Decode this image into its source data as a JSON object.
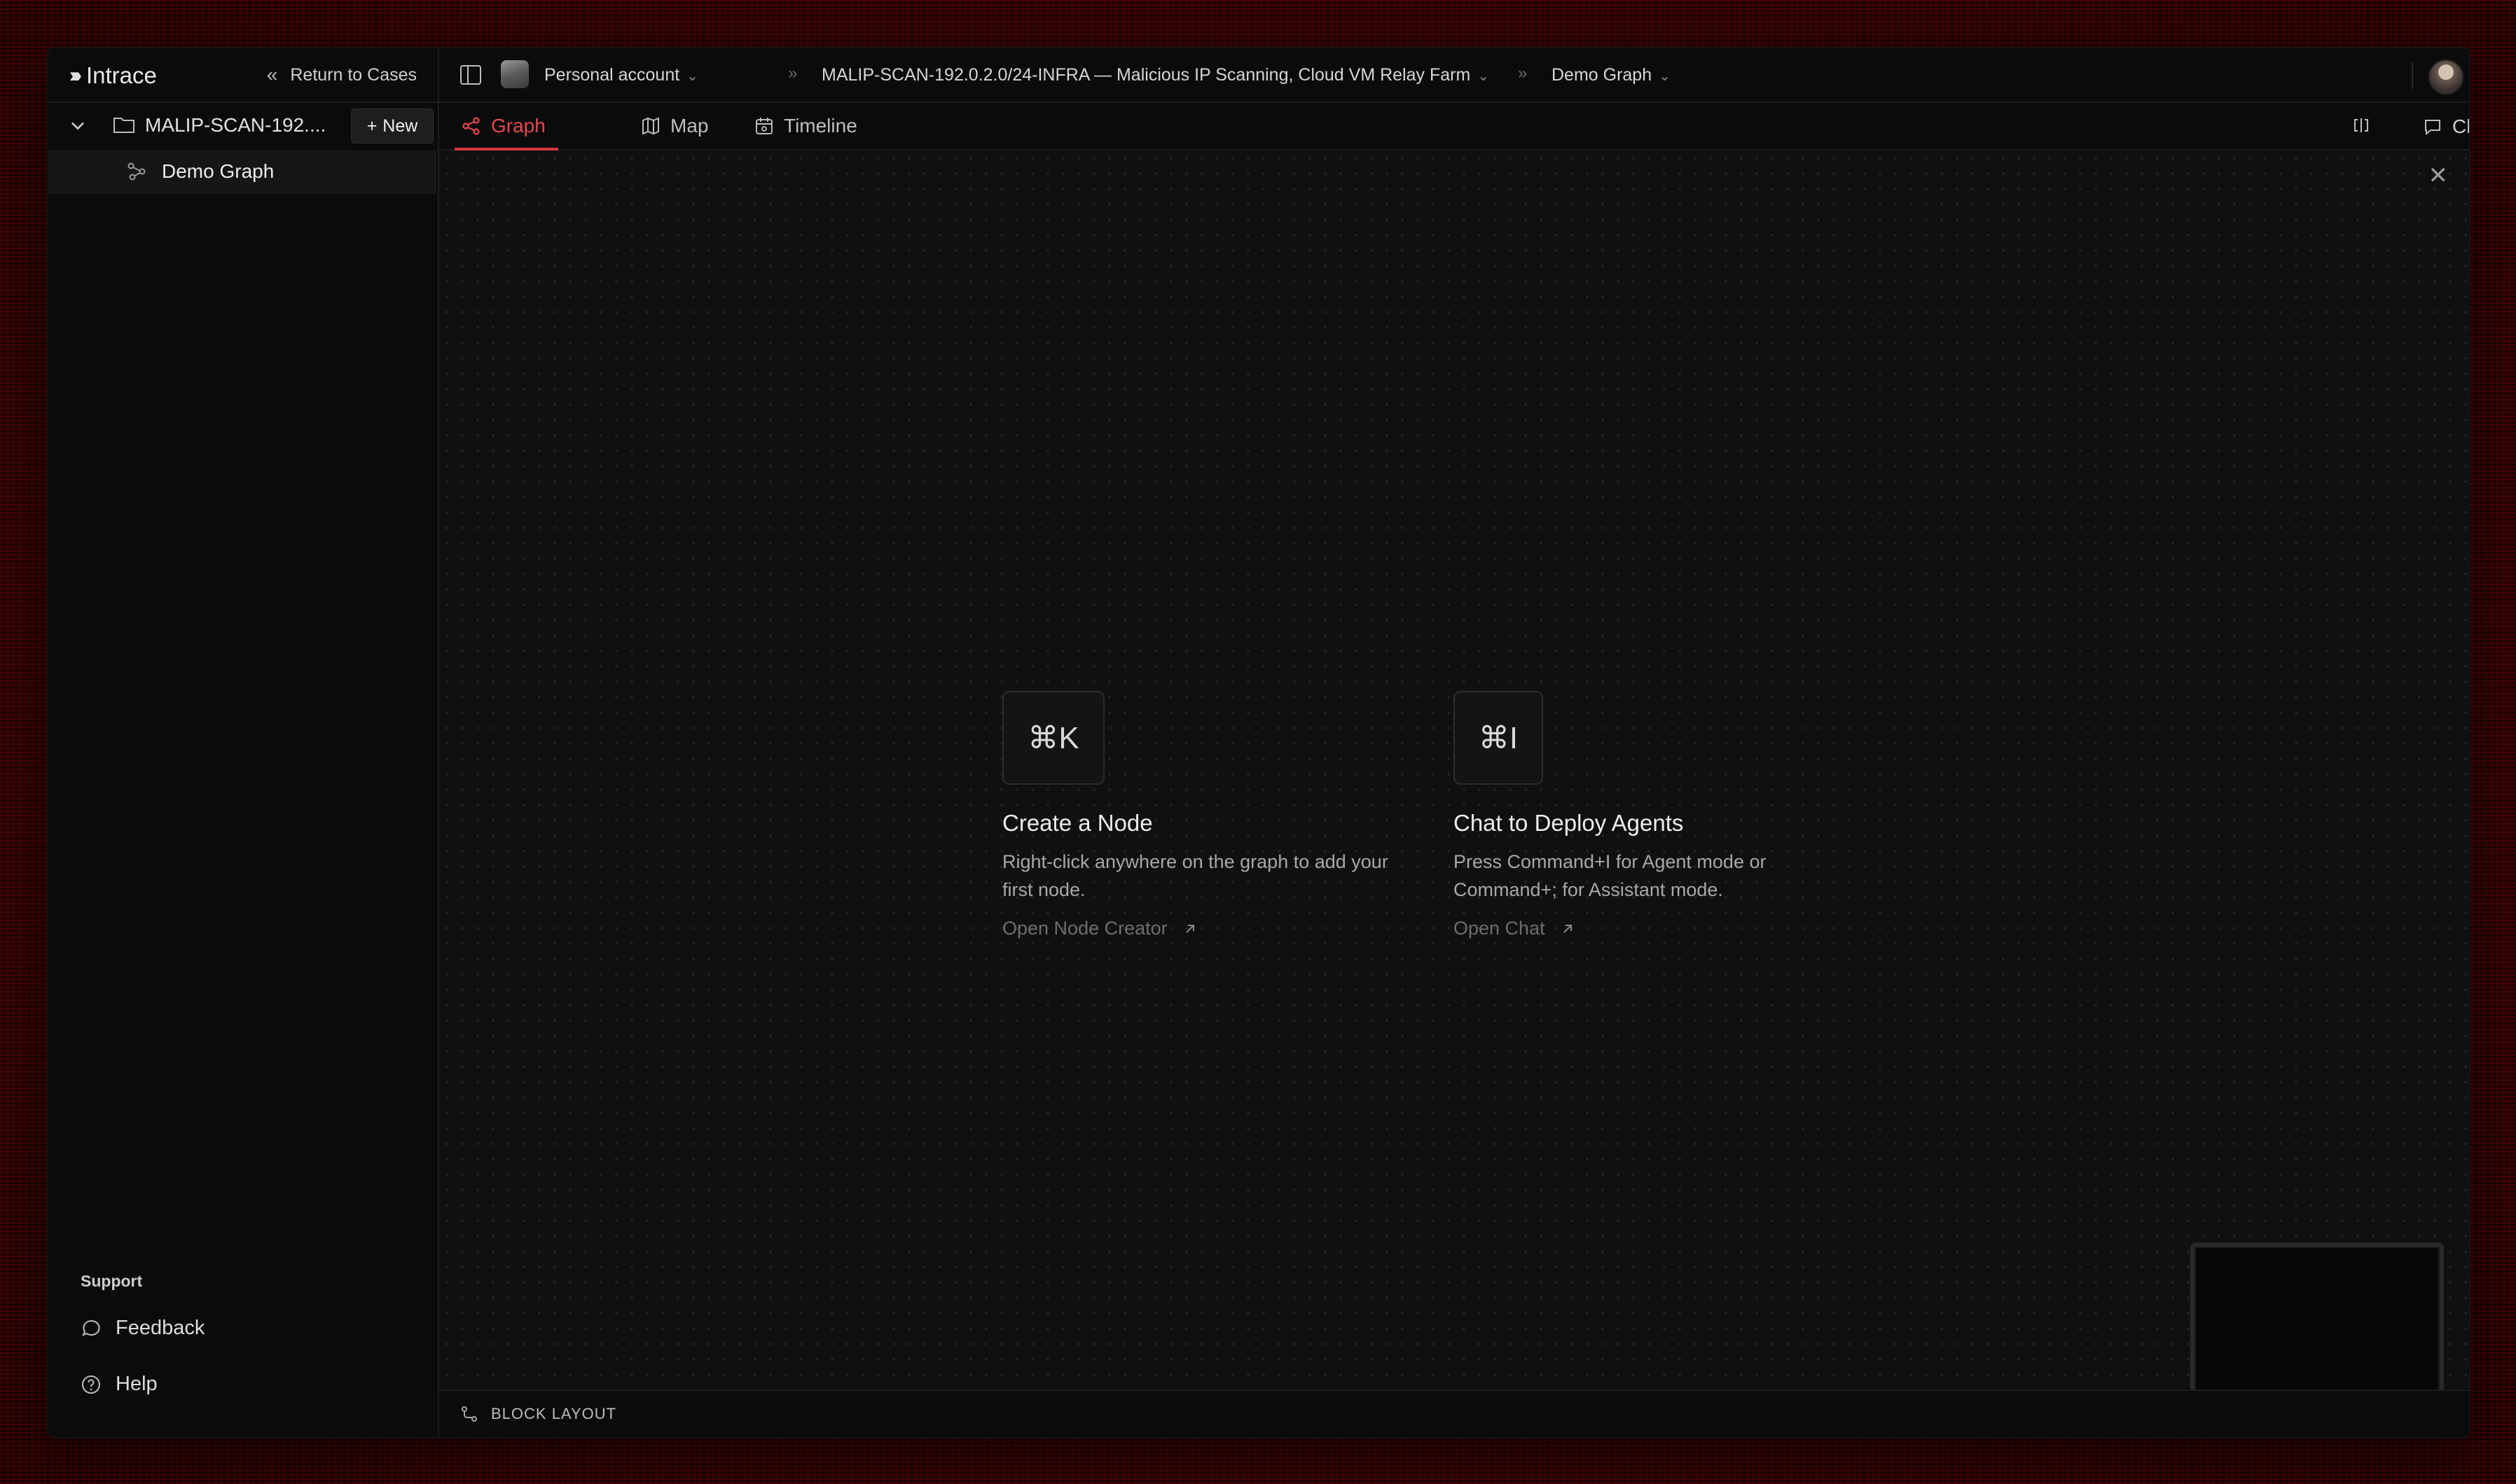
{
  "app": {
    "brand": "Intrace",
    "accent": "#e5484d"
  },
  "sidebar": {
    "return_label": "Return to Cases",
    "case_name": "MALIP-SCAN-192....",
    "new_label": "New",
    "graph_item": "Demo Graph",
    "support_title": "Support",
    "links": [
      {
        "label": "Feedback",
        "icon": "chat-bubble-icon"
      },
      {
        "label": "Help",
        "icon": "help-circle-icon"
      }
    ]
  },
  "topbar": {
    "account": "Personal account",
    "case_full": "MALIP-SCAN-192.0.2.0/24-INFRA — Malicious IP Scanning, Cloud VM Relay Farm",
    "graph": "Demo Graph"
  },
  "tabs": [
    {
      "label": "Graph",
      "active": true,
      "icon": "graph-icon"
    },
    {
      "label": "Map",
      "active": false,
      "icon": "map-icon"
    },
    {
      "label": "Timeline",
      "active": false,
      "icon": "calendar-icon"
    }
  ],
  "toolbar_right": {
    "chat_label": "Chat"
  },
  "canvas": {
    "cards": [
      {
        "shortcut": "⌘K",
        "title": "Create a Node",
        "desc": "Right-click anywhere on the graph to add your first node.",
        "link": "Open Node Creator"
      },
      {
        "shortcut": "⌘I",
        "title": "Chat to Deploy Agents",
        "desc": "Press Command+I for Agent mode or Command+; for Assistant mode.",
        "link": "Open Chat"
      }
    ]
  },
  "bottombar": {
    "label": "BLOCK LAYOUT"
  }
}
